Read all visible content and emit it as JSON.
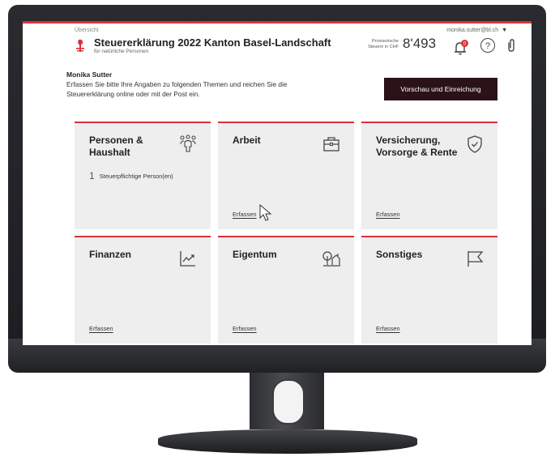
{
  "header": {
    "breadcrumb": "Übersicht",
    "title": "Steuererklärung 2022 Kanton Basel-Landschaft",
    "subtitle": "für natürliche Personen",
    "user_email": "monika.sutter@bl.ch",
    "tax_label_line1": "Provisorische",
    "tax_label_line2": "Steuern in CHF",
    "tax_value": "8'493",
    "notification_count": "0",
    "help_glyph": "?"
  },
  "intro": {
    "user_name": "Monika Sutter",
    "text": "Erfassen Sie bitte Ihre Angaben zu folgenden Themen und reichen Sie die Steuererklärung online oder mit der Post ein.",
    "primary_button": "Vorschau und Einreichung"
  },
  "cards": [
    {
      "title": "Personen & Haushalt",
      "icon": "people-icon",
      "detail_count": "1",
      "detail_text": "Steuerpflichtige Person(en)",
      "link": ""
    },
    {
      "title": "Arbeit",
      "icon": "briefcase-icon",
      "detail_count": "",
      "detail_text": "",
      "link": "Erfassen"
    },
    {
      "title": "Versicherung, Vorsorge & Rente",
      "icon": "shield-icon",
      "detail_count": "",
      "detail_text": "",
      "link": "Erfassen"
    },
    {
      "title": "Finanzen",
      "icon": "chart-icon",
      "detail_count": "",
      "detail_text": "",
      "link": "Erfassen"
    },
    {
      "title": "Eigentum",
      "icon": "property-icon",
      "detail_count": "",
      "detail_text": "",
      "link": "Erfassen"
    },
    {
      "title": "Sonstiges",
      "icon": "flag-icon",
      "detail_count": "",
      "detail_text": "",
      "link": "Erfassen"
    }
  ],
  "colors": {
    "accent": "#d9323a",
    "primary_button_bg": "#2b1219",
    "card_bg": "#eeeeee",
    "bezel": "#1c1d20"
  }
}
